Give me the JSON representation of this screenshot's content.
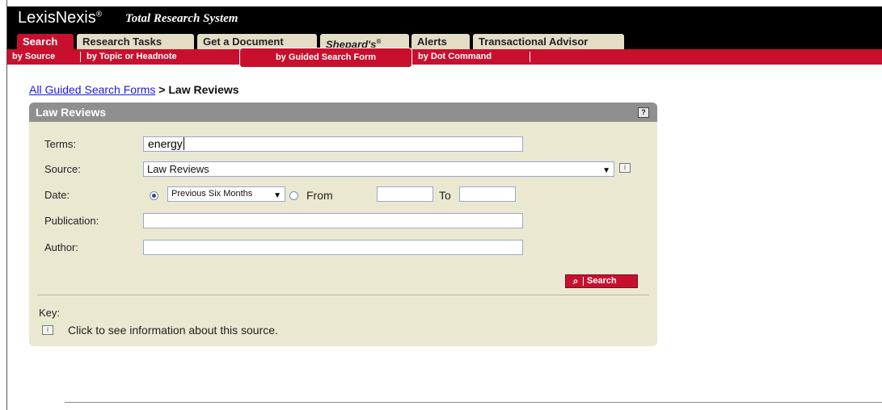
{
  "brand": {
    "logo": "LexisNexis",
    "reg": "®",
    "subtitle": "Total Research System"
  },
  "tabs": [
    {
      "label": "Search",
      "active": true
    },
    {
      "label": "Research Tasks"
    },
    {
      "label": "Get a Document"
    },
    {
      "label": "Shepard's",
      "sup": "®"
    },
    {
      "label": "Alerts"
    },
    {
      "label": "Transactional Advisor"
    }
  ],
  "subnav": {
    "by_source": "by Source",
    "by_topic": "by Topic or Headnote",
    "by_guided": "by Guided Search Form",
    "by_dot": "by Dot Command"
  },
  "breadcrumb": {
    "link": "All Guided Search Forms",
    "sep": " > ",
    "current": "Law Reviews"
  },
  "panel": {
    "title": "Law Reviews",
    "help_icon": "help-question-icon",
    "terms_label": "Terms:",
    "terms_value": "energy",
    "source_label": "Source:",
    "source_value": "Law Reviews",
    "date_label": "Date:",
    "date_option": "Previous Six Months",
    "from_label": "From",
    "to_label": "To",
    "from_value": "",
    "to_value": "",
    "publication_label": "Publication:",
    "publication_value": "",
    "author_label": "Author:",
    "author_value": "",
    "search_button": "Search",
    "key_label": "Key:",
    "key_info_text": "Click to see information about this source."
  },
  "colors": {
    "brand_red": "#c8102e",
    "panel_bg": "#ebe8d2",
    "panel_head": "#8f8f8f",
    "tab_bg": "#e4ddc6"
  }
}
